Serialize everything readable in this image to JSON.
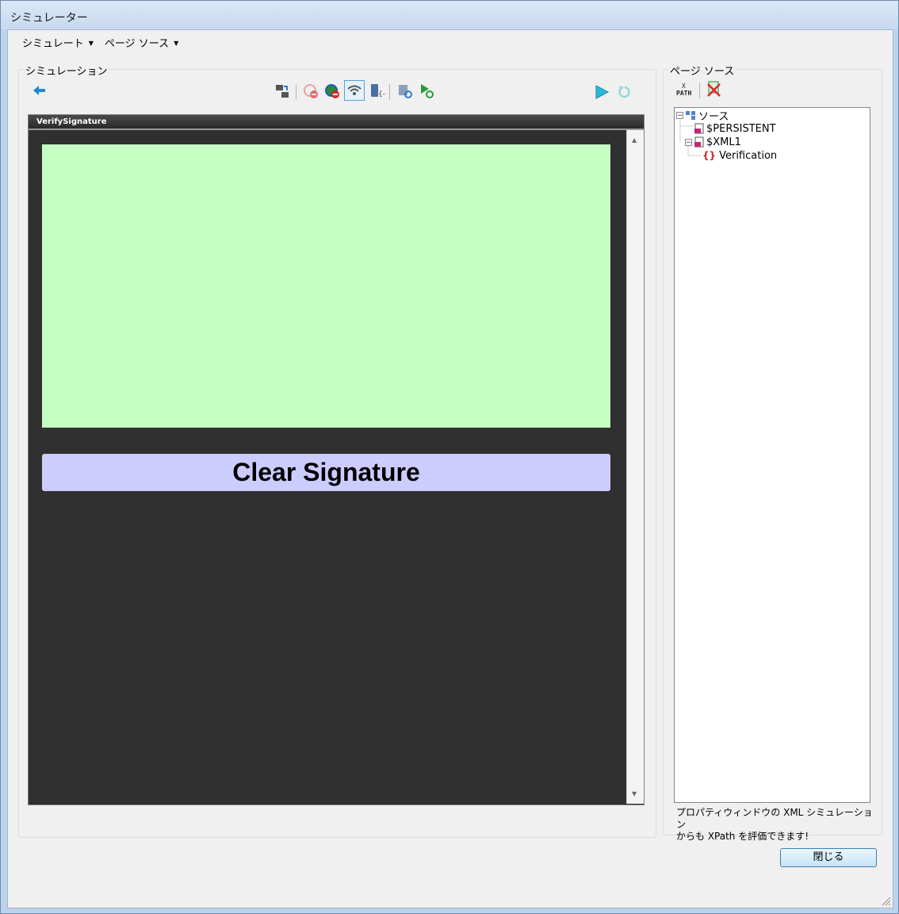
{
  "window": {
    "title": "シミュレーター"
  },
  "menubar": {
    "items": [
      {
        "label": "シミュレート"
      },
      {
        "label": "ページ ソース"
      }
    ]
  },
  "simulation_panel": {
    "label": "シミュレーション"
  },
  "device": {
    "title": "VerifySignature",
    "clear_button_label": "Clear Signature",
    "signature_color": "#c4ffc4",
    "button_color": "#ccccff"
  },
  "page_source_panel": {
    "label": "ページ ソース",
    "tree": [
      {
        "label": "ソース"
      },
      {
        "label": "$PERSISTENT"
      },
      {
        "label": "$XML1"
      },
      {
        "label": "Verification"
      }
    ],
    "hint_line1": "プロパティウィンドウの XML シミュレーション",
    "hint_line2": "からも XPath を評価できます!"
  },
  "footer": {
    "close_label": "閉じる"
  },
  "toolbar": {
    "xpath_icon_text_top": "X",
    "xpath_icon_text_bottom": "PATH"
  }
}
